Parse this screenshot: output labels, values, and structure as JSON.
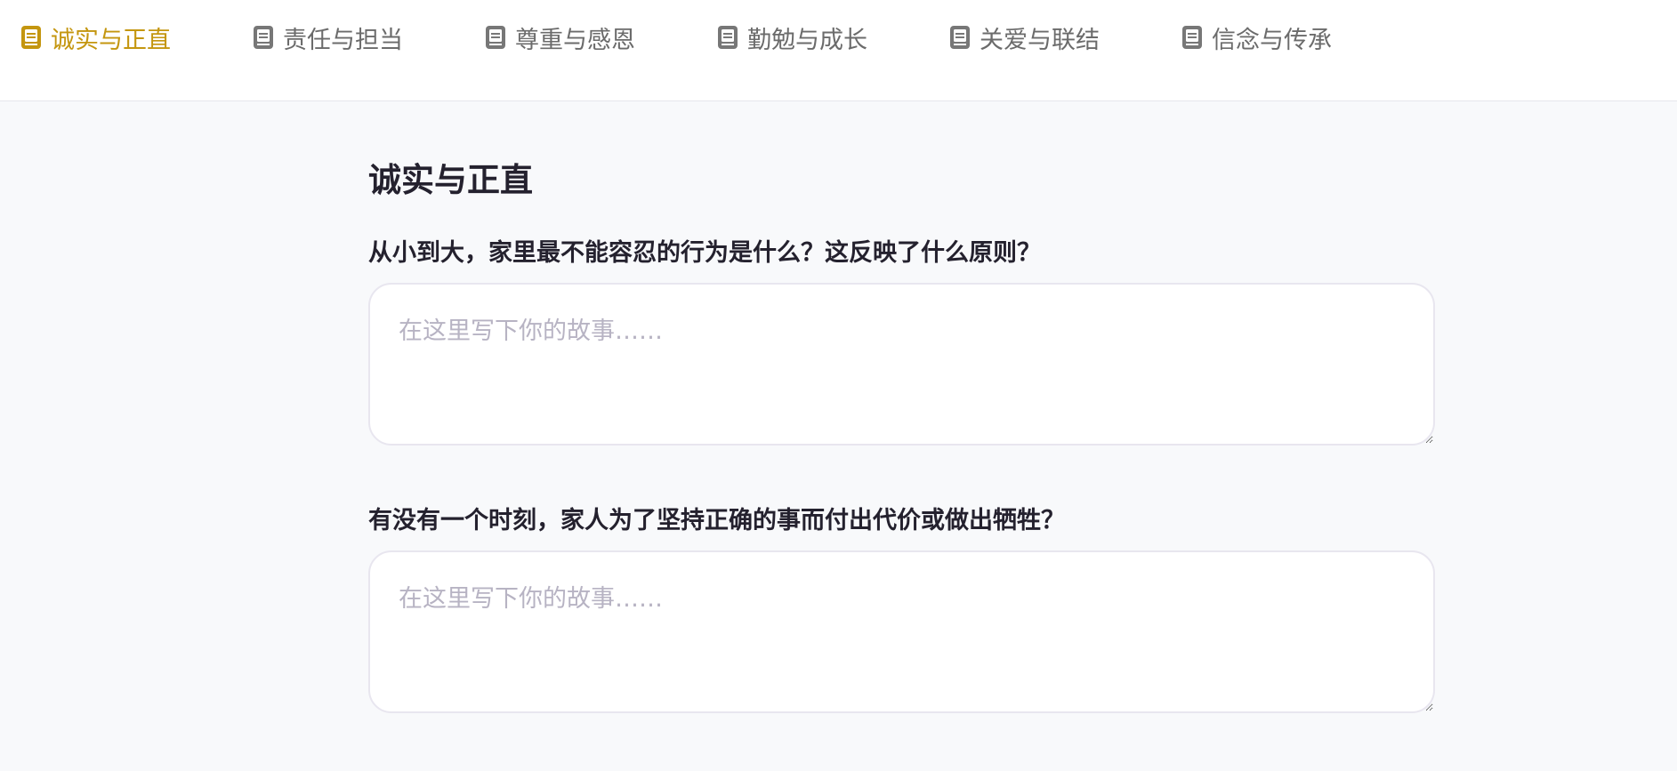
{
  "nav": {
    "tabs": [
      {
        "label": "诚实与正直",
        "icon": "book-icon",
        "active": true
      },
      {
        "label": "责任与担当",
        "icon": "book-icon",
        "active": false
      },
      {
        "label": "尊重与感恩",
        "icon": "book-icon",
        "active": false
      },
      {
        "label": "勤勉与成长",
        "icon": "book-icon",
        "active": false
      },
      {
        "label": "关爱与联结",
        "icon": "book-icon",
        "active": false
      },
      {
        "label": "信念与传承",
        "icon": "book-icon",
        "active": false
      }
    ]
  },
  "section": {
    "title": "诚实与正直",
    "questions": [
      {
        "text": "从小到大，家里最不能容忍的行为是什么？这反映了什么原则？",
        "value": "",
        "placeholder": "在这里写下你的故事……"
      },
      {
        "text": "有没有一个时刻，家人为了坚持正确的事而付出代价或做出牺牲？",
        "value": "",
        "placeholder": "在这里写下你的故事……"
      }
    ]
  },
  "colors": {
    "accent": "#c4960f",
    "tab_inactive": "#6b6b6b",
    "background": "#f8f9fb",
    "heading": "#24212e",
    "placeholder": "#b7b3c3"
  }
}
